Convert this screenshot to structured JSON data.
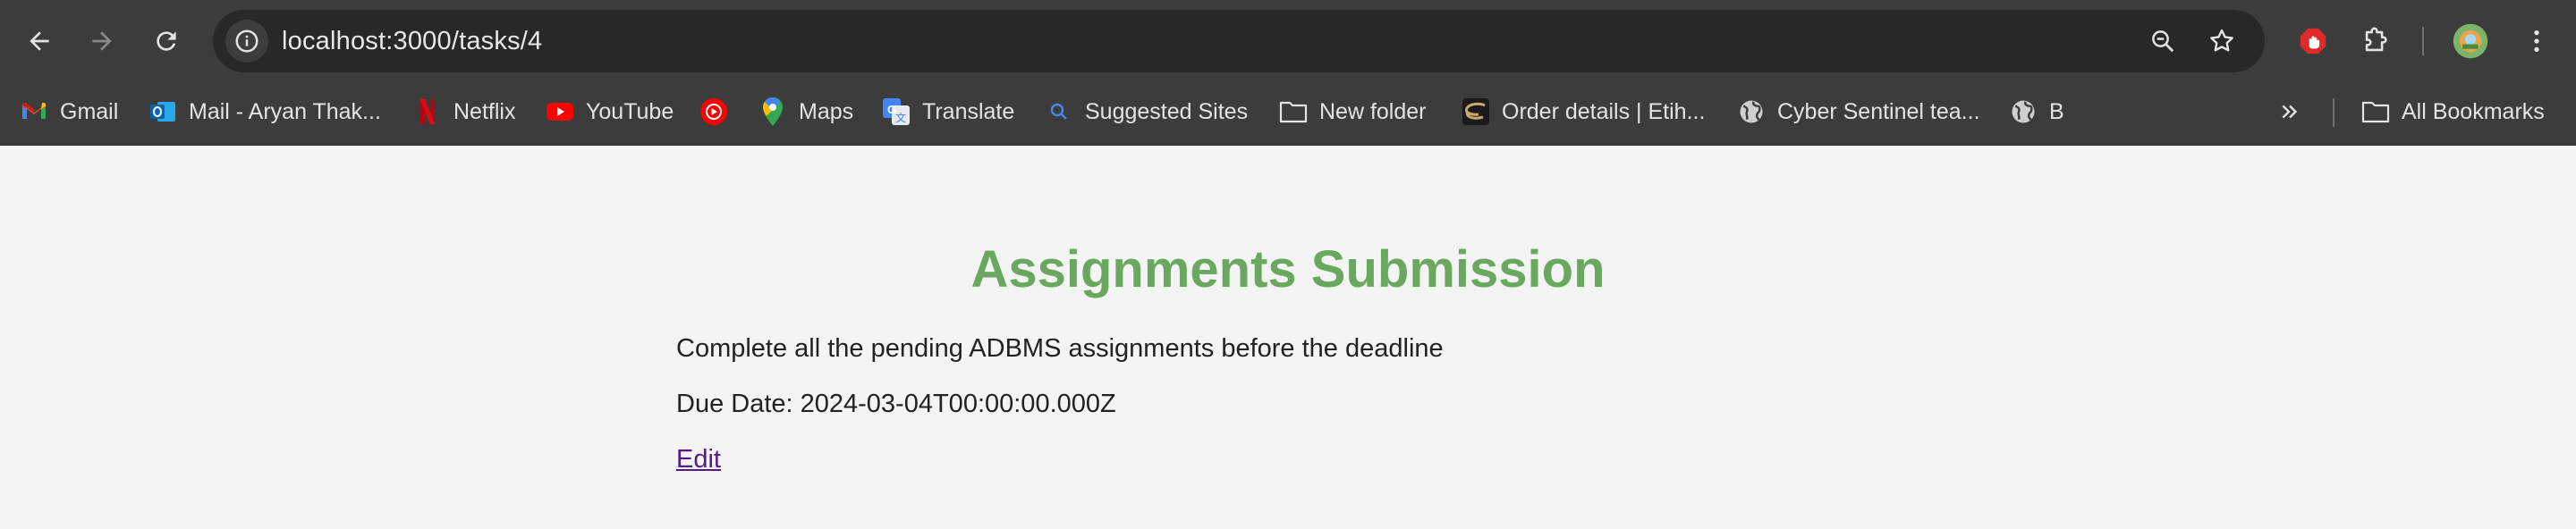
{
  "browser": {
    "url": "localhost:3000/tasks/4",
    "bookmarks": [
      {
        "label": "Gmail",
        "icon": "gmail-icon"
      },
      {
        "label": "Mail - Aryan Thak...",
        "icon": "outlook-icon"
      },
      {
        "label": "Netflix",
        "icon": "netflix-icon"
      },
      {
        "label": "YouTube",
        "icon": "youtube-icon"
      },
      {
        "label": "",
        "icon": "youtube-music-icon"
      },
      {
        "label": "Maps",
        "icon": "maps-icon"
      },
      {
        "label": "Translate",
        "icon": "translate-icon"
      },
      {
        "label": "Suggested Sites",
        "icon": "search-icon"
      },
      {
        "label": "New folder",
        "icon": "folder-icon"
      },
      {
        "label": "Order details | Etih...",
        "icon": "etihad-icon"
      },
      {
        "label": "Cyber Sentinel tea...",
        "icon": "globe-icon"
      },
      {
        "label": "B",
        "icon": "globe-icon"
      }
    ],
    "all_bookmarks_label": "All Bookmarks"
  },
  "page": {
    "title": "Assignments Submission",
    "description": "Complete all the pending ADBMS assignments before the deadline",
    "due_date": "Due Date: 2024-03-04T00:00:00.000Z",
    "edit_link": "Edit"
  },
  "colors": {
    "title": "#6aa85f",
    "link": "#551a8b",
    "chrome": "#3c3c3c",
    "page_bg": "#f4f4f4"
  }
}
